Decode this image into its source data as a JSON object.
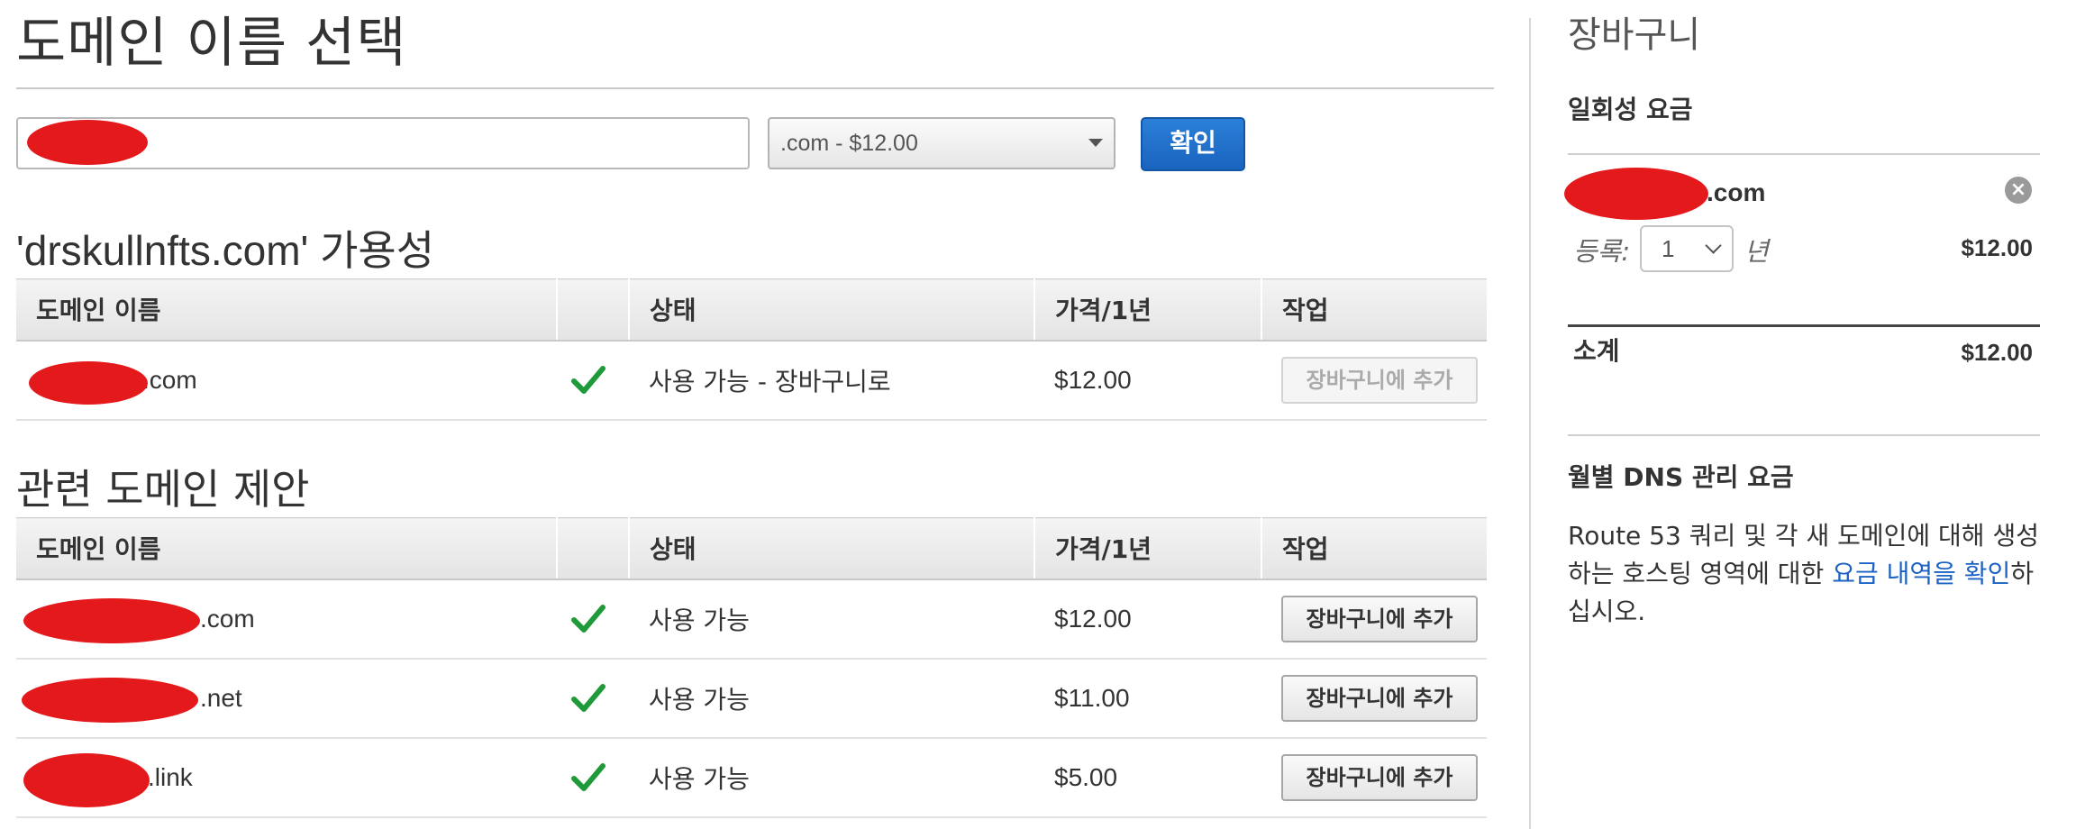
{
  "main": {
    "title": "도메인 이름 선택",
    "search": {
      "value": ""
    },
    "tld_select": {
      "selected": ".com - $12.00"
    },
    "confirm_label": "확인",
    "availability_title": "'drskullnfts.com' 가용성",
    "table_headers": [
      "도메인 이름",
      "",
      "상태",
      "가격/1년",
      "작업"
    ],
    "availability_rows": [
      {
        "domain_suffix": ".com",
        "status": "사용 가능 - 장바구니로",
        "price": "$12.00",
        "action": "장바구니에 추가",
        "action_disabled": true
      }
    ],
    "suggestions_title": "관련 도메인 제안",
    "suggestion_rows": [
      {
        "domain_suffix": ".com",
        "status": "사용 가능",
        "price": "$12.00",
        "action": "장바구니에 추가"
      },
      {
        "domain_suffix": ".net",
        "status": "사용 가능",
        "price": "$11.00",
        "action": "장바구니에 추가"
      },
      {
        "domain_suffix": ".link",
        "status": "사용 가능",
        "price": "$5.00",
        "action": "장바구니에 추가"
      }
    ]
  },
  "cart": {
    "title": "장바구니",
    "one_time_heading": "일회성 요금",
    "item": {
      "domain_suffix": ".com",
      "reg_label": "등록:",
      "years": "1",
      "years_unit": "년",
      "price": "$12.00"
    },
    "subtotal_label": "소계",
    "subtotal_value": "$12.00",
    "monthly_heading": "월별 DNS 관리 요금",
    "dns_text_before": "Route 53 쿼리 및 각 새 도메인에 대해 생성하는 호스팅 영역에 대한 ",
    "dns_link": "요금 내역을 확인",
    "dns_text_after": "하십시오."
  },
  "colors": {
    "accent_blue": "#1a64be",
    "check_green": "#1e9a3a",
    "redaction_red": "#e3191c",
    "link_blue": "#1a62c4"
  },
  "icons": {
    "check": "check-icon",
    "remove": "remove-icon",
    "caret": "caret-down-icon"
  }
}
